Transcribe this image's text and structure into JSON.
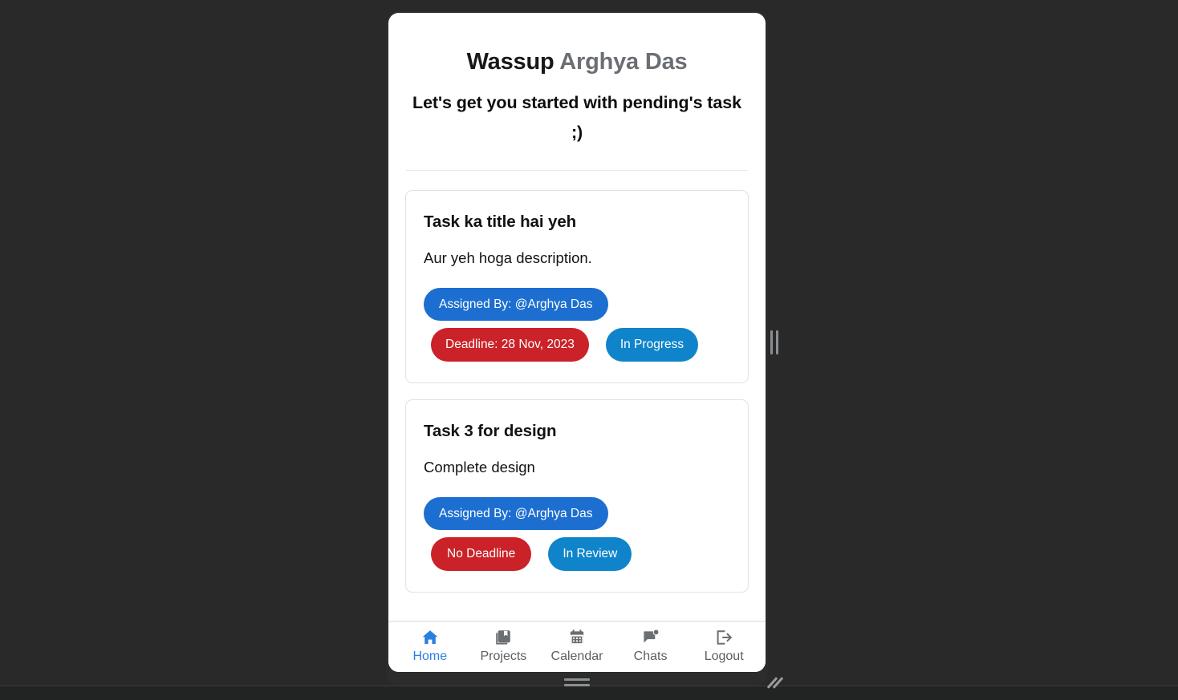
{
  "greeting": {
    "salutation": "Wassup",
    "user_name": "Arghya Das",
    "subtitle": "Let's get you started with pending's task ;)"
  },
  "tasks": [
    {
      "title": "Task ka title hai yeh",
      "description": "Aur yeh hoga description.",
      "assigned_by": "Assigned By: @Arghya Das",
      "deadline": "Deadline: 28 Nov, 2023",
      "status": "In Progress"
    },
    {
      "title": "Task 3 for design",
      "description": "Complete design",
      "assigned_by": "Assigned By: @Arghya Das",
      "deadline": "No Deadline",
      "status": "In Review"
    }
  ],
  "bottom_nav": {
    "items": [
      {
        "label": "Home",
        "icon": "home-icon",
        "active": true
      },
      {
        "label": "Projects",
        "icon": "library-icon",
        "active": false
      },
      {
        "label": "Calendar",
        "icon": "calendar-icon",
        "active": false
      },
      {
        "label": "Chats",
        "icon": "chat-bubble-icon",
        "active": false
      },
      {
        "label": "Logout",
        "icon": "logout-icon",
        "active": false
      }
    ]
  },
  "colors": {
    "accent_blue": "#2b7fe0",
    "badge_assigned_blue": "#1c6fd0",
    "badge_status_blue": "#0f84ca",
    "badge_deadline_red": "#ca2228",
    "page_background": "#292929",
    "nav_inactive": "#5a5f63"
  }
}
